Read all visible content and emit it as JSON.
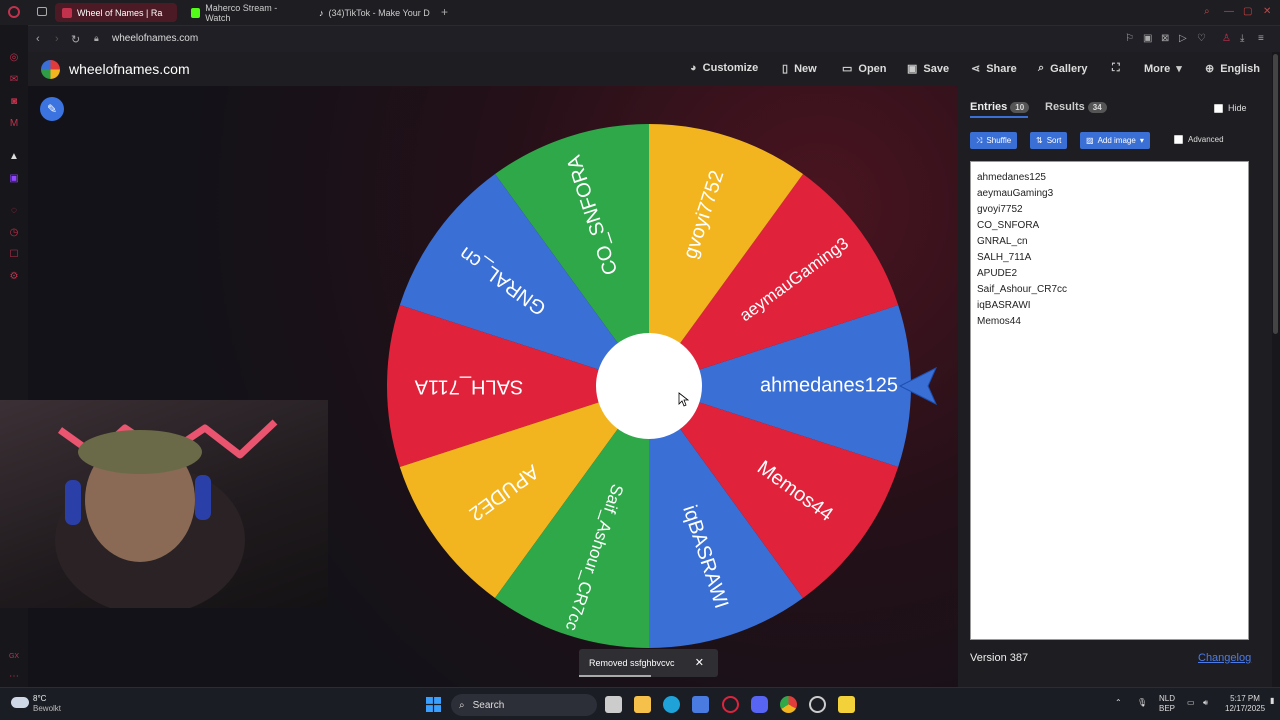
{
  "browser": {
    "tabs": [
      {
        "label": "Wheel of Names | Ra",
        "color": "#c2324d"
      },
      {
        "label": "Maherco Stream - Watch",
        "color": "#53fc18"
      },
      {
        "label": "(34)TikTok - Make Your D",
        "color": "#ffffff"
      }
    ],
    "url": "wheelofnames.com"
  },
  "app": {
    "logo_text": "wheelofnames.com",
    "menu": {
      "customize": "Customize",
      "new": "New",
      "open": "Open",
      "save": "Save",
      "share": "Share",
      "gallery": "Gallery",
      "more": "More",
      "language": "English"
    }
  },
  "wheel": {
    "slice_colors": [
      "#3a6fd6",
      "#e0223b",
      "#f2b51f",
      "#2fa84a"
    ],
    "segments": [
      "ahmedanes125",
      "aeymauGaming3",
      "gvoyi7752",
      "CO_SNFORA",
      "GNRAL_cn",
      "SALH_711A",
      "APUDE2",
      "Saif_Ashour_CR7cc",
      "iqBASRAWI",
      "Memos44"
    ]
  },
  "panel": {
    "entries_tab": "Entries",
    "entries_count": "10",
    "results_tab": "Results",
    "results_count": "34",
    "hide_label": "Hide",
    "shuffle": "Shuffle",
    "sort": "Sort",
    "add_image": "Add image",
    "advanced": "Advanced",
    "entries": [
      "ahmedanes125",
      "aeymauGaming3",
      "gvoyi7752",
      "CO_SNFORA",
      "GNRAL_cn",
      "SALH_711A",
      "APUDE2",
      "Saif_Ashour_CR7cc",
      "iqBASRAWI",
      "Memos44"
    ],
    "version": "Version 387",
    "changelog": "Changelog"
  },
  "toast": {
    "message": "Removed ssfghbvcvc"
  },
  "taskbar": {
    "weather_temp": "8°C",
    "weather_desc": "Bewolkt",
    "search_label": "Search",
    "lang1": "NLD",
    "lang2": "BEP",
    "time": "5:17 PM",
    "date": "12/17/2025"
  }
}
